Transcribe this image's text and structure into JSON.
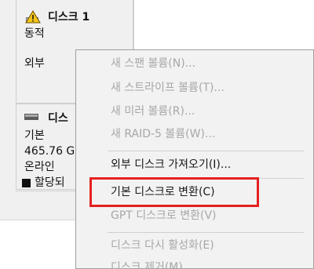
{
  "disk1": {
    "title": "디스크 1",
    "status": "동적",
    "type": "외부"
  },
  "disk0": {
    "title": "디스",
    "kind": "기본",
    "size": "465.76 G",
    "state": "온라인"
  },
  "legend": {
    "label": "할당되"
  },
  "menu": {
    "items": [
      {
        "label": "새 스팬 볼륨(N)...",
        "enabled": false
      },
      {
        "label": "새 스트라이프 볼륨(T)...",
        "enabled": false
      },
      {
        "label": "새 미러 볼륨(R)...",
        "enabled": false
      },
      {
        "label": "새 RAID-5 볼륨(W)...",
        "enabled": false
      },
      {
        "label": "외부 디스크 가져오기(I)...",
        "enabled": true
      },
      {
        "label": "기본 디스크로 변환(C)",
        "enabled": true
      },
      {
        "label": "GPT 디스크로 변환(V)",
        "enabled": false
      },
      {
        "label": "디스크 다시 활성화(E)",
        "enabled": false
      },
      {
        "label": "디스크 제거(M)",
        "enabled": false
      }
    ]
  },
  "colors": {
    "highlight": "#e52020",
    "disabled_text": "#a7a7a7",
    "menu_bg": "#f2f2f2",
    "disk_bar": "#1f3f9c"
  },
  "icons": {
    "disk1": "warning-disk-icon",
    "disk0": "disk-icon"
  }
}
